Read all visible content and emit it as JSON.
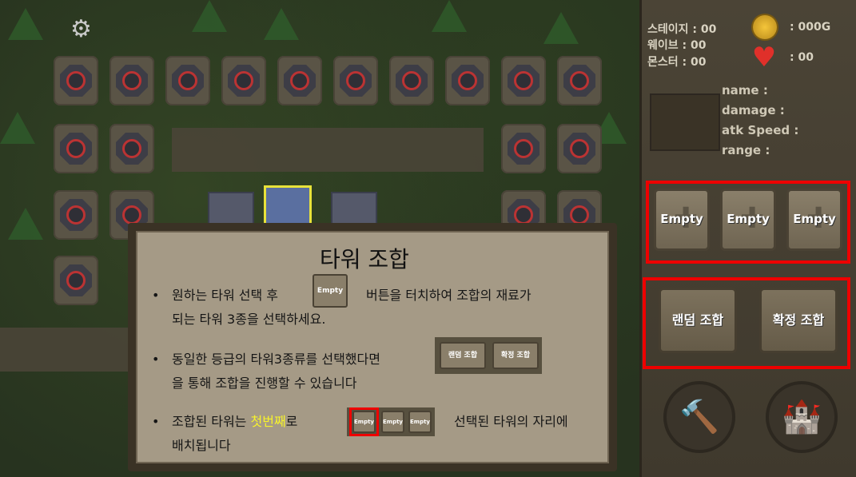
{
  "hud": {
    "stage_label": "스테이지 : 00",
    "wave_label": "웨이브 : 00",
    "monster_label": "몬스터 : 00",
    "gold_label": ": 000G",
    "life_label": ": 00"
  },
  "tower_info": {
    "name_label": "name :",
    "damage_label": "damage :",
    "atk_speed_label": "atk Speed :",
    "range_label": "range :"
  },
  "combine_slots": [
    "Empty",
    "Empty",
    "Empty"
  ],
  "combine_buttons": {
    "random": "랜덤 조합",
    "confirm": "확정 조합"
  },
  "icons": {
    "settings": "gear-icon",
    "gold": "coin-icon",
    "life": "heart-icon",
    "build": "hammer-icon",
    "castle": "castle-icon"
  },
  "tutorial": {
    "title": "타워 조합",
    "bullet1_a": "원하는 타워 선택 후",
    "bullet1_b": "버튼을 터치하여 조합의 재료가",
    "bullet1_c": "되는 타워  3종을 선택하세요.",
    "bullet2_a": "동일한 등급의 타워3종류를 선택했다면",
    "bullet2_b": "을 통해 조합을 진행할 수 있습니다",
    "bullet3_a": "조합된 타워는",
    "bullet3_hl": "첫번째",
    "bullet3_b": "로",
    "bullet3_c": "선택된 타워의 자리에",
    "bullet3_d": "배치됩니다",
    "mini_empty": "Empty",
    "mini_random": "랜덤 조합",
    "mini_confirm": "확정 조합",
    "bullet_char": "•"
  },
  "colors": {
    "highlight": "#f6f22c",
    "red_frame": "#ee0000"
  }
}
